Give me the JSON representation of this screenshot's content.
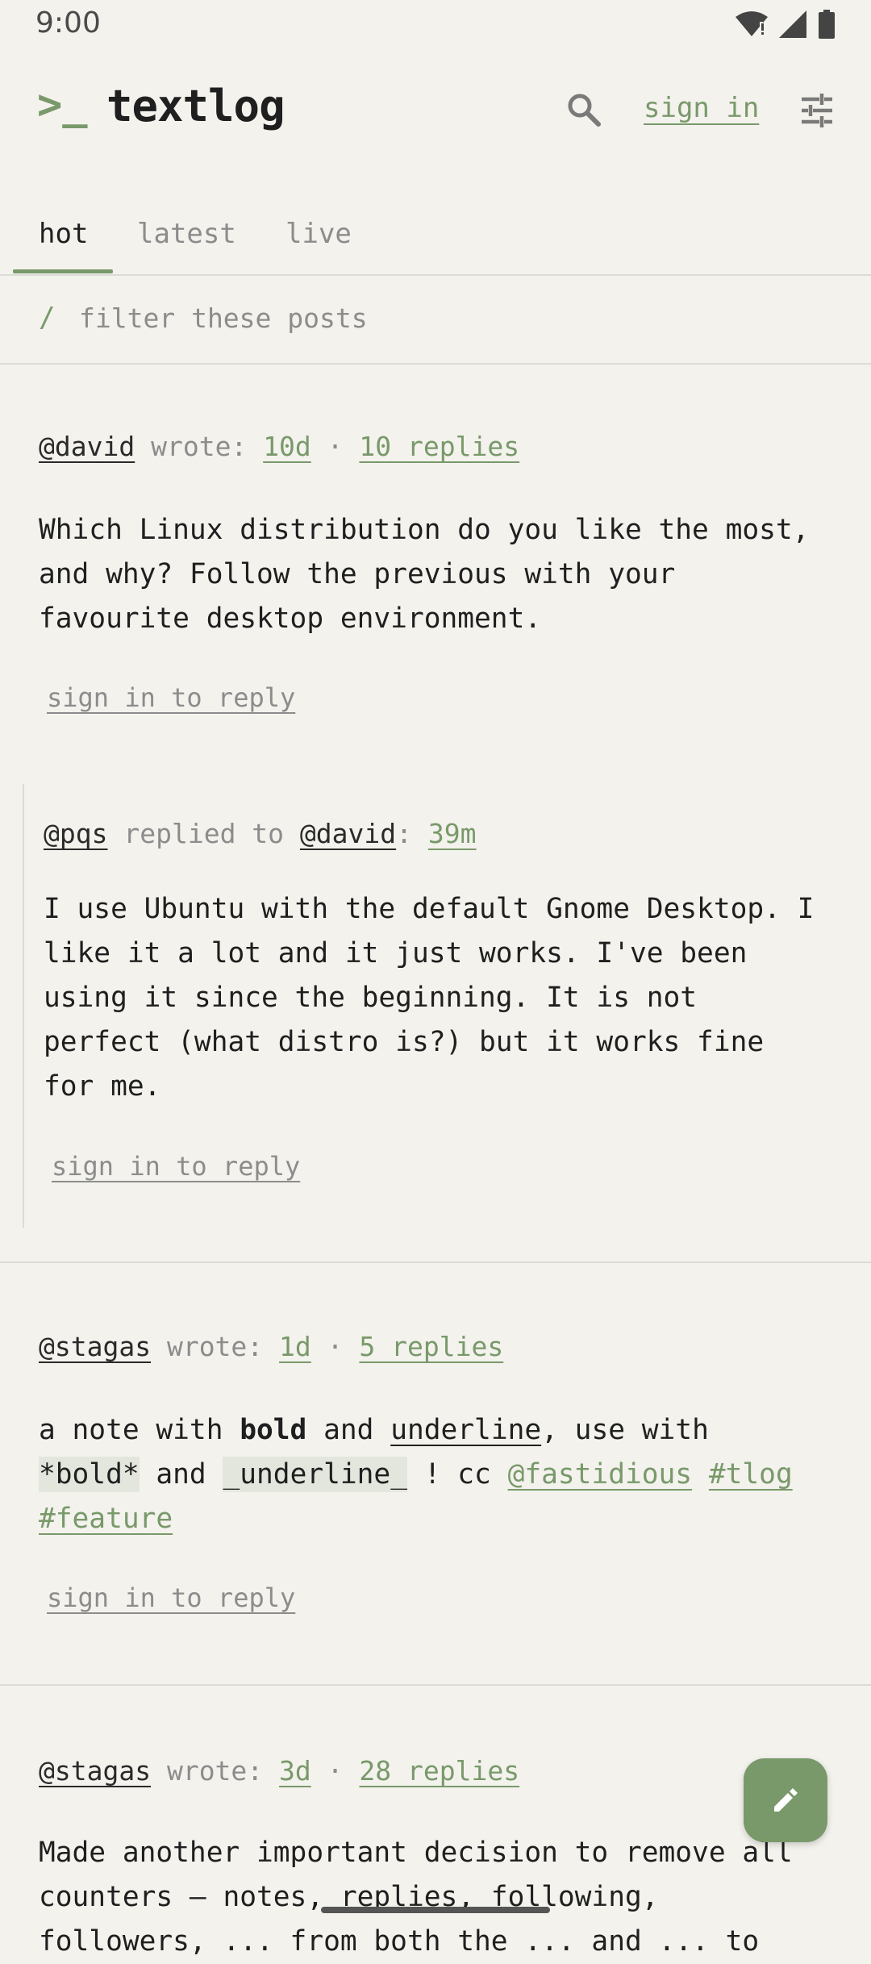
{
  "status_bar": {
    "time": "9:00",
    "icons": [
      "wifi-icon",
      "signal-icon",
      "battery-icon"
    ]
  },
  "header": {
    "logo_prompt": ">_",
    "title": "textlog",
    "search_icon": "search-icon",
    "sign_in_label": "sign in",
    "settings_icon": "tune-icon"
  },
  "tabs": [
    {
      "label": "hot",
      "active": true
    },
    {
      "label": "latest",
      "active": false
    },
    {
      "label": "live",
      "active": false
    }
  ],
  "filter": {
    "slash": "/",
    "placeholder": "filter these posts"
  },
  "posts": [
    {
      "author": "@david",
      "action": "wrote:",
      "age": "10d",
      "separator": "·",
      "replies": "10 replies",
      "body": "Which Linux distribution do you like the most,\nand why? Follow the previous with your\nfavourite desktop environment.",
      "reply_link": "sign in to reply"
    },
    {
      "author": "@pqs",
      "action": "replied to",
      "target": "@david",
      "colon": ":",
      "age": "39m",
      "body": "I use Ubuntu with the default Gnome Desktop. I\nlike it a lot and it just works. I've been\nusing it since the beginning. It is not\nperfect (what distro is?) but it works fine\nfor me.",
      "reply_link": "sign in to reply"
    },
    {
      "author": "@stagas",
      "action": "wrote:",
      "age": "1d",
      "separator": "·",
      "replies": "5 replies",
      "body_parts": {
        "t1": "a note with ",
        "bold": "bold",
        "t2": " and ",
        "underline": "underline",
        "t3": ", use with",
        "code1": "*bold*",
        "t4": " and ",
        "code2": "_underline_",
        "t5": " ! cc ",
        "mention": "@fastidious",
        "tag1": "#tlog",
        "tag2": "#feature"
      },
      "reply_link": "sign in to reply"
    },
    {
      "author": "@stagas",
      "action": "wrote:",
      "age": "3d",
      "separator": "·",
      "replies": "28 replies",
      "body": "Made another important decision to remove all\ncounters — notes, replies, following,\nfollowers, ... from both the ... and ... to"
    }
  ],
  "fab_icon": "pencil-icon",
  "colors": {
    "accent": "#79996a",
    "background": "#f3f2ed",
    "muted": "#8c8c8c"
  }
}
